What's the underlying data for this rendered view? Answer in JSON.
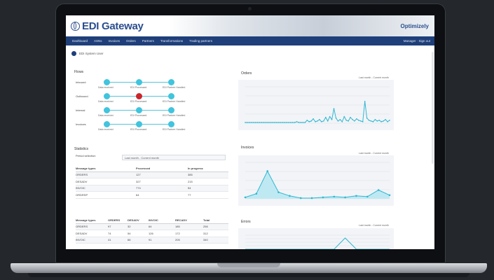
{
  "app": {
    "title": "EDI Gateway",
    "brand": "Optimizely",
    "user_label": "EDI System User"
  },
  "nav": {
    "items": [
      "Dashboard",
      "ASNs",
      "Invoices",
      "Orders",
      "Partners",
      "Transformations",
      "Trading partners"
    ],
    "right": "Manager · Sign out"
  },
  "flow": {
    "title": "Flows",
    "rows": [
      {
        "label": "Inbound",
        "nodes": [
          "Data received",
          "EDI Processed",
          "EDI Partner Handled"
        ],
        "error_index": -1
      },
      {
        "label": "Outbound",
        "nodes": [
          "Data received",
          "EDI Processed",
          "EDI Partner Handled"
        ],
        "error_index": 1
      },
      {
        "label": "Internal",
        "nodes": [
          "Data received",
          "EDI Processed",
          "EDI Partner Handled"
        ],
        "error_index": -1
      },
      {
        "label": "Invoices",
        "nodes": [
          "Data received",
          "EDI Processed",
          "EDI Partner Handled"
        ],
        "error_index": -1
      }
    ]
  },
  "stats": {
    "title": "Statistics",
    "period_label": "Period selection",
    "period_value": "Last month - Current month",
    "table1": {
      "headers": [
        "Message types",
        "Processed",
        "In progress"
      ],
      "rows": [
        [
          "ORDERS",
          "127",
          "385"
        ],
        [
          "DESADV",
          "327",
          "215"
        ],
        [
          "INVOIC",
          "774",
          "54"
        ],
        [
          "ORDRSP",
          "64",
          "77"
        ]
      ]
    },
    "table2": {
      "headers": [
        "Message types",
        "ORDERS",
        "DESADV",
        "INVOIC",
        "RECADV",
        "Total"
      ],
      "rows": [
        [
          "ORDERS",
          "97",
          "32",
          "64",
          "185",
          "256"
        ],
        [
          "DESADV",
          "74",
          "54",
          "126",
          "172",
          "312"
        ],
        [
          "INVOIC",
          "41",
          "66",
          "91",
          "205",
          "340"
        ]
      ]
    }
  },
  "charts": {
    "orders": {
      "title": "Orders",
      "range": "Last month - Current month"
    },
    "invoices": {
      "title": "Invoices",
      "range": "Last month - Current month"
    },
    "errors": {
      "title": "Errors",
      "range": "Last month - Current month"
    }
  },
  "chart_data": [
    {
      "type": "line",
      "title": "Orders",
      "values": [
        1,
        1,
        1,
        1,
        1,
        1,
        1,
        1,
        1,
        1,
        1,
        1,
        1,
        1,
        1,
        1,
        1,
        1,
        1,
        1,
        1,
        1,
        1,
        1,
        1,
        2,
        1,
        1,
        1,
        1,
        4,
        2,
        3,
        6,
        2,
        3,
        5,
        2,
        3,
        8,
        3,
        9,
        5,
        20,
        7,
        3,
        5,
        2,
        9,
        4,
        3,
        8,
        5,
        3,
        6,
        4,
        3,
        2,
        30,
        7,
        4,
        3,
        2,
        5,
        3,
        4,
        2,
        3,
        5,
        2,
        4
      ],
      "ylim": [
        0,
        50
      ]
    },
    {
      "type": "area",
      "title": "Invoices",
      "values": [
        2,
        7,
        38,
        9,
        4,
        1,
        1,
        2,
        3,
        2,
        4,
        3,
        12,
        5
      ],
      "ylim": [
        0,
        50
      ]
    },
    {
      "type": "line",
      "title": "Errors",
      "values": [
        0,
        0,
        0,
        0,
        0,
        0,
        0,
        0,
        0,
        40,
        0,
        0,
        0,
        0
      ],
      "ylim": [
        0,
        50
      ]
    }
  ]
}
